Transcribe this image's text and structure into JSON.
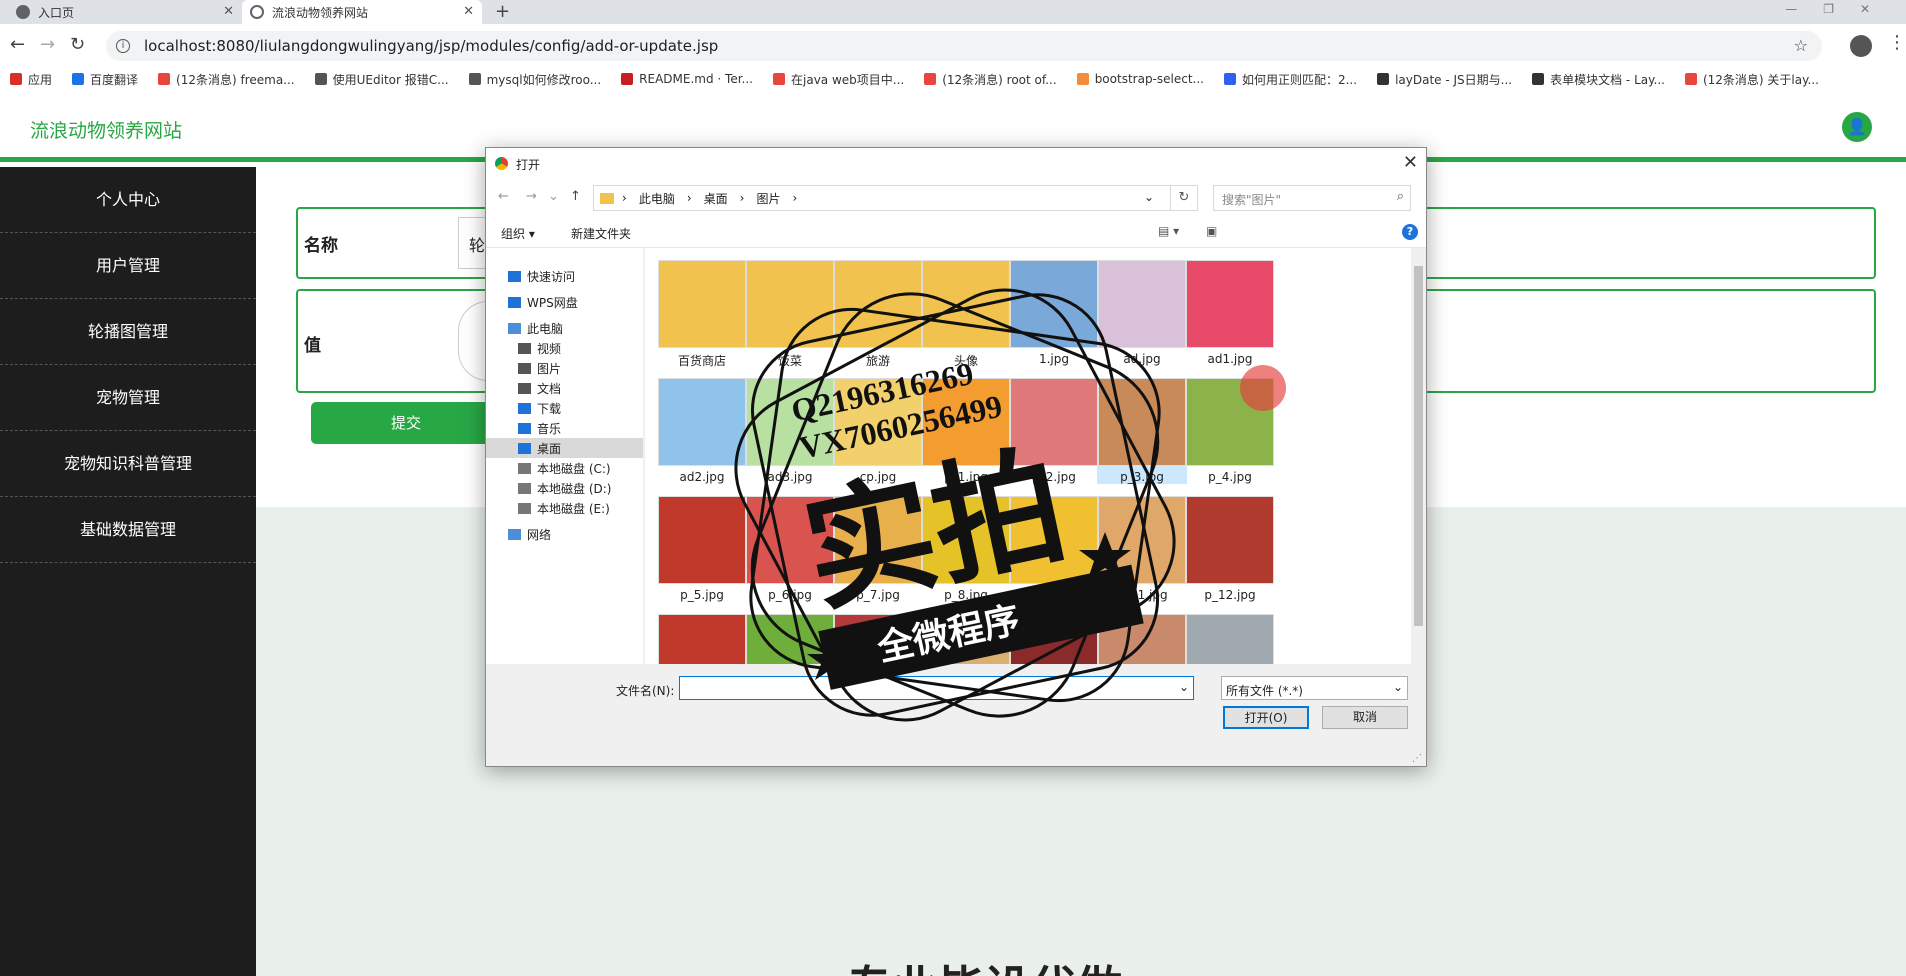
{
  "browser": {
    "tabs": [
      {
        "title": "入口页"
      },
      {
        "title": "流浪动物领养网站"
      }
    ],
    "new_tab": "+",
    "url": "localhost:8080/liulangdongwulingyang/jsp/modules/config/add-or-update.jsp",
    "bookmarks": [
      {
        "label": "应用",
        "color": "#d93025"
      },
      {
        "label": "百度翻译",
        "color": "#1a73e8"
      },
      {
        "label": "(12条消息) freema...",
        "color": "#e8453c"
      },
      {
        "label": "使用UEditor 报错C...",
        "color": "#555555"
      },
      {
        "label": "mysql如何修改roo...",
        "color": "#555555"
      },
      {
        "label": "README.md · Ter...",
        "color": "#c71d23"
      },
      {
        "label": "在java web项目中...",
        "color": "#e8453c"
      },
      {
        "label": "(12条消息) root of...",
        "color": "#e8453c"
      },
      {
        "label": "bootstrap-select...",
        "color": "#f28b3a"
      },
      {
        "label": "如何用正则匹配：2...",
        "color": "#3061f2"
      },
      {
        "label": "layDate - JS日期与...",
        "color": "#333333"
      },
      {
        "label": "表单模块文档 - Lay...",
        "color": "#333333"
      },
      {
        "label": "(12条消息) 关于lay...",
        "color": "#e8453c"
      }
    ]
  },
  "site": {
    "title": "流浪动物领养网站",
    "accent": "#28a745",
    "sidebar": [
      {
        "label": "个人中心"
      },
      {
        "label": "用户管理"
      },
      {
        "label": "轮播图管理"
      },
      {
        "label": "宠物管理"
      },
      {
        "label": "宠物知识科普管理"
      },
      {
        "label": "基础数据管理"
      }
    ],
    "form": {
      "name_label": "名称",
      "name_value": "轮",
      "value_label": "值",
      "submit": "提交"
    },
    "bottom_heading": "专业毕设代做"
  },
  "dialog": {
    "title": "打开",
    "breadcrumb": [
      "此电脑",
      "桌面",
      "图片"
    ],
    "search_placeholder": "搜索\"图片\"",
    "organize": "组织",
    "new_folder": "新建文件夹",
    "help": "?",
    "nav": [
      {
        "label": "快速访问",
        "color": "#1e73d8"
      },
      {
        "label": "WPS网盘",
        "color": "#1e73d8"
      },
      {
        "label": "此电脑",
        "color": "#4a8fd8"
      },
      {
        "label": "视频",
        "color": "#555555"
      },
      {
        "label": "图片",
        "color": "#555555"
      },
      {
        "label": "文档",
        "color": "#555555"
      },
      {
        "label": "下载",
        "color": "#1e73d8"
      },
      {
        "label": "音乐",
        "color": "#1e73d8"
      },
      {
        "label": "桌面",
        "color": "#1e73d8"
      },
      {
        "label": "本地磁盘 (C:)",
        "color": "#777777"
      },
      {
        "label": "本地磁盘 (D:)",
        "color": "#777777"
      },
      {
        "label": "本地磁盘 (E:)",
        "color": "#777777"
      },
      {
        "label": "网络",
        "color": "#4a8fd8"
      }
    ],
    "files": [
      {
        "name": "百货商店",
        "color": "#f1c24e"
      },
      {
        "name": "饭菜",
        "color": "#f1c24e"
      },
      {
        "name": "旅游",
        "color": "#f1c24e"
      },
      {
        "name": "头像",
        "color": "#f1c24e"
      },
      {
        "name": "1.jpg",
        "color": "#7aa8d8"
      },
      {
        "name": "ad.jpg",
        "color": "#d9c2d9"
      },
      {
        "name": "ad1.jpg",
        "color": "#e84a6a"
      },
      {
        "name": "ad2.jpg",
        "color": "#8fc3ea"
      },
      {
        "name": "ad3.jpg",
        "color": "#b8e0a0"
      },
      {
        "name": "cp.jpg",
        "color": "#f2d06b"
      },
      {
        "name": "p_1.jpg",
        "color": "#f39c2f"
      },
      {
        "name": "p_2.jpg",
        "color": "#e07a7a"
      },
      {
        "name": "p_3.jpg",
        "color": "#c98a5a"
      },
      {
        "name": "p_4.jpg",
        "color": "#8bb34a"
      },
      {
        "name": "p_5.jpg",
        "color": "#c0392b"
      },
      {
        "name": "p_6.jpg",
        "color": "#d9534f"
      },
      {
        "name": "p_7.jpg",
        "color": "#e8b04a"
      },
      {
        "name": "p_8.jpg",
        "color": "#e6c229"
      },
      {
        "name": "p_9.jpg",
        "color": "#f0c030"
      },
      {
        "name": "p_11.jpg",
        "color": "#e0a868"
      },
      {
        "name": "p_12.jpg",
        "color": "#b03a2e"
      },
      {
        "name": "",
        "color": "#c0392b"
      },
      {
        "name": "",
        "color": "#6fae3a"
      },
      {
        "name": "",
        "color": "#b23a3a"
      },
      {
        "name": "",
        "color": "#d9b070"
      },
      {
        "name": "",
        "color": "#8a2a2a"
      },
      {
        "name": "",
        "color": "#c88a6a"
      },
      {
        "name": "",
        "color": "#a0a8b0"
      }
    ],
    "filename_label": "文件名(N):",
    "filetype": "所有文件 (*.*)",
    "open": "打开(O)",
    "cancel": "取消"
  },
  "watermark": {
    "qq": "Q2196316269",
    "vx": "VX7060256499",
    "big": "实拍",
    "banner": "全微程序"
  }
}
